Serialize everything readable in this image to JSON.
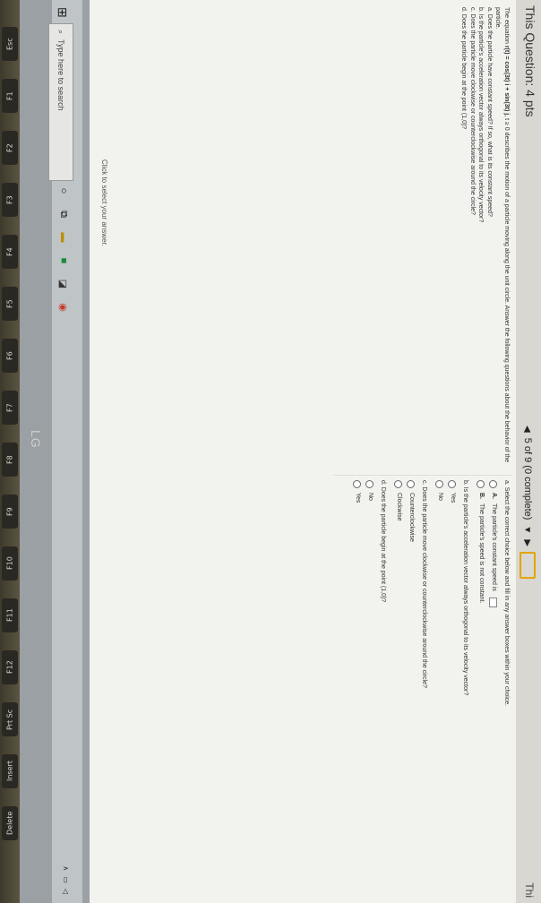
{
  "header": {
    "title": "This Question: 4 pts",
    "progress": "5 of 9 (0 complete)",
    "this_word": "Thi"
  },
  "question": {
    "prefix": "The equation ",
    "equation": "r(t) = cos(3t) i + sin(3t) j",
    "suffix": ", t ≥ 0 describes the motion of a particle moving along the unit circle. Answer the following questions about the behavior of the particle.",
    "items": [
      "a. Does the particle have constant speed? If so, what is its constant speed?",
      "b. Is the particle's acceleration vector always orthogonal to its velocity vector?",
      "c. Does the particle move clockwise or counterclockwise around the circle?",
      "d. Does the particle begin at the point (1,0)?"
    ],
    "click_hint": "Click to select your answer."
  },
  "answers": {
    "a_label": "a. Select the correct choice below and fill in any answer boxes within your choice.",
    "a_opt_a_letter": "A.",
    "a_opt_a_text": "The particle's constant speed is",
    "a_opt_b_letter": "B.",
    "a_opt_b_text": "The particle's speed is not constant.",
    "b_label": "b. Is the particle's acceleration vector always orthogonal to its velocity vector?",
    "b_opts": [
      "Yes",
      "No"
    ],
    "c_label": "c. Does the particle move clockwise or counterclockwise around the circle?",
    "c_opts": [
      "Counterclockwise",
      "Clockwise"
    ],
    "d_label": "d. Does the particle begin at the point (1,0)?",
    "d_opts": [
      "No",
      "Yes"
    ]
  },
  "taskbar": {
    "search_placeholder": "Type here to search",
    "brand": "LG"
  },
  "keyboard": {
    "keys": [
      "Esc",
      "F1",
      "F2",
      "F3",
      "F4",
      "F5",
      "F6",
      "F7",
      "F8",
      "F9",
      "F10",
      "F11",
      "F12",
      "Prt Sc",
      "Insert",
      "Delete"
    ]
  }
}
